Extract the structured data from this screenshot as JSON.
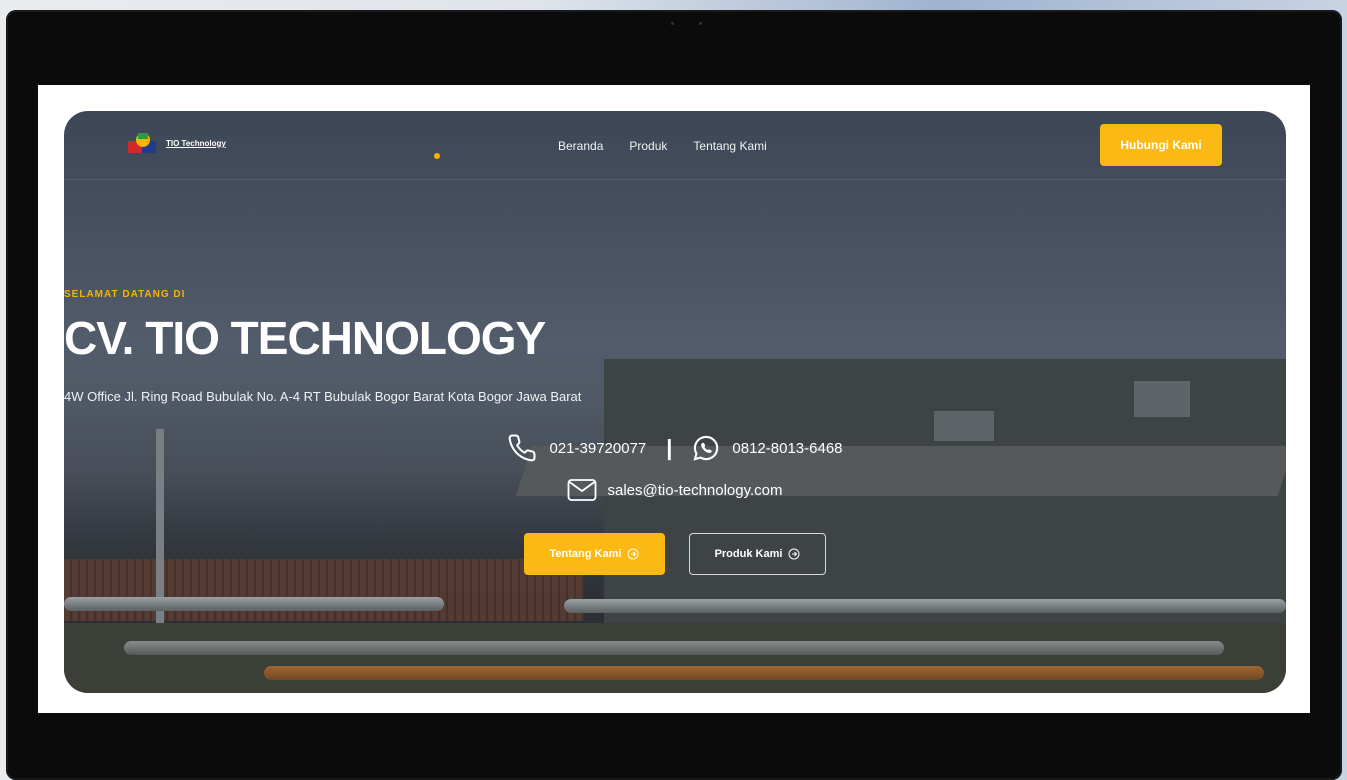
{
  "brand": {
    "name": "TIO Technology"
  },
  "nav": {
    "items": [
      {
        "label": "Beranda"
      },
      {
        "label": "Produk"
      },
      {
        "label": "Tentang Kami"
      }
    ],
    "cta_label": "Hubungi Kami"
  },
  "hero": {
    "eyebrow": "SELAMAT DATANG DI",
    "title": "CV. TIO TECHNOLOGY",
    "address": "4W Office Jl. Ring Road Bubulak No. A-4 RT Bubulak Bogor Barat Kota Bogor Jawa Barat",
    "phone": "021-39720077",
    "separator": "|",
    "whatsapp": "0812-8013-6468",
    "email": "sales@tio-technology.com",
    "primary_button": "Tentang Kami",
    "secondary_button": "Produk Kami"
  },
  "colors": {
    "accent": "#fdb913",
    "text": "#ffffff"
  },
  "icons": {
    "phone": "phone-icon",
    "whatsapp": "whatsapp-icon",
    "email": "mail-icon",
    "arrow": "arrow-right-circle-icon"
  }
}
